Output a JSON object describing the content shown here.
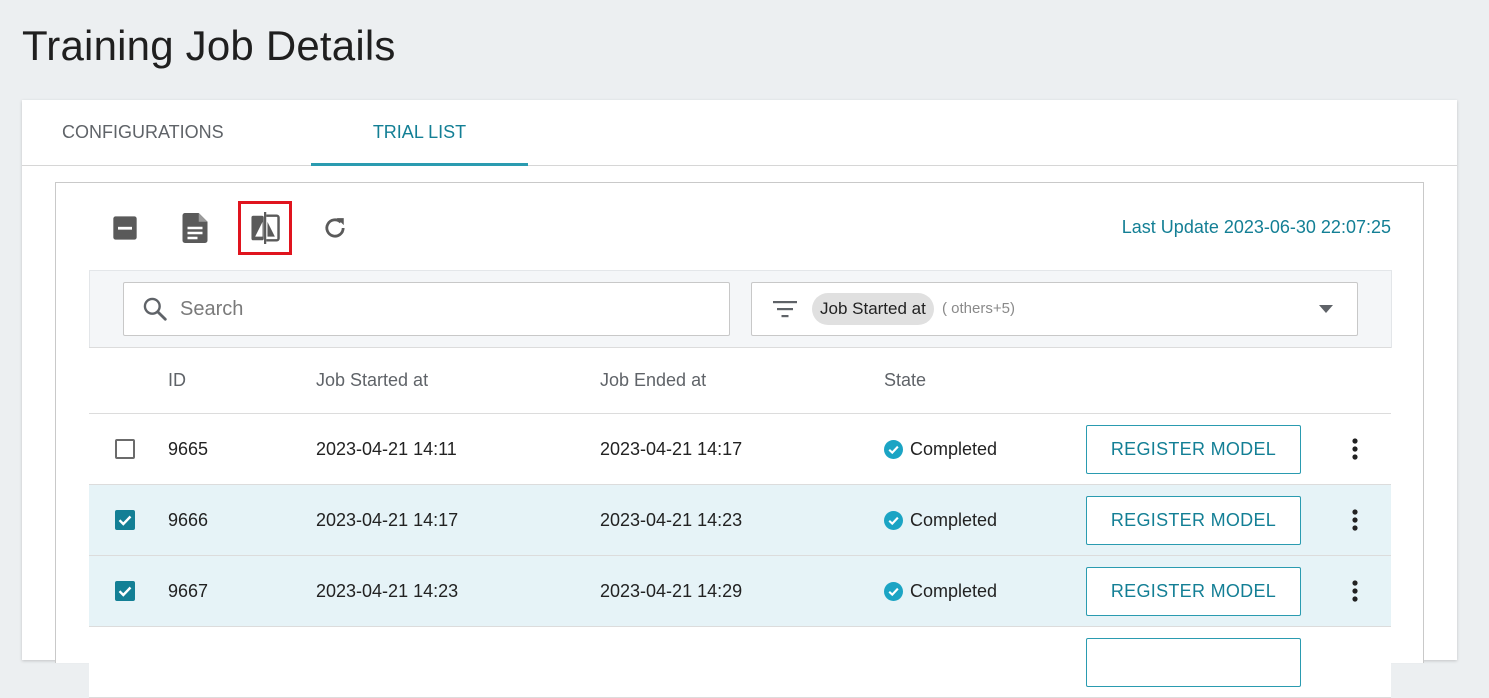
{
  "page": {
    "title": "Training Job Details"
  },
  "tabs": [
    {
      "label": "CONFIGURATIONS",
      "active": false
    },
    {
      "label": "TRIAL LIST",
      "active": true
    }
  ],
  "toolbar": {
    "icons": [
      "collapse-icon",
      "document-icon",
      "compare-icon",
      "refresh-icon"
    ],
    "last_update": "Last Update 2023-06-30 22:07:25"
  },
  "search": {
    "placeholder": "Search",
    "value": ""
  },
  "column_filter": {
    "chip": "Job Started at",
    "others": "( others+5)"
  },
  "table": {
    "columns": [
      "ID",
      "Job Started at",
      "Job Ended at",
      "State"
    ],
    "rows": [
      {
        "id": "9665",
        "started": "2023-04-21 14:11",
        "ended": "2023-04-21 14:17",
        "state": "Completed",
        "action": "REGISTER MODEL",
        "checked": false
      },
      {
        "id": "9666",
        "started": "2023-04-21 14:17",
        "ended": "2023-04-21 14:23",
        "state": "Completed",
        "action": "REGISTER MODEL",
        "checked": true
      },
      {
        "id": "9667",
        "started": "2023-04-21 14:23",
        "ended": "2023-04-21 14:29",
        "state": "Completed",
        "action": "REGISTER MODEL",
        "checked": true
      }
    ]
  },
  "colors": {
    "accent": "#137f95",
    "state_ok": "#1ba4c4",
    "highlight": "#e0141e",
    "selected_row": "#e6f3f7"
  }
}
